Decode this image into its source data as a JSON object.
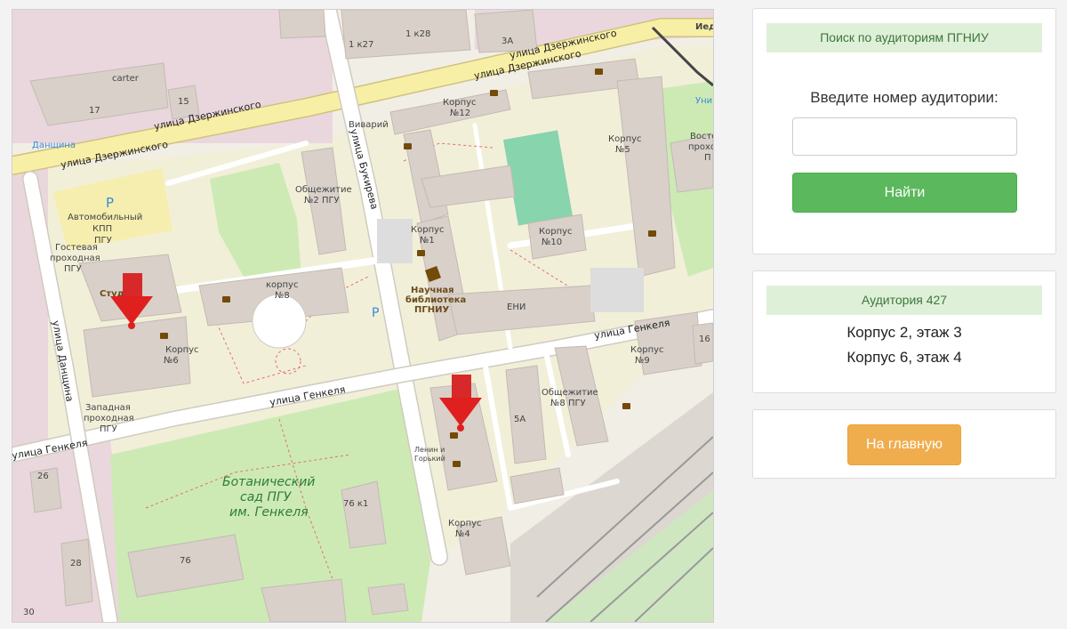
{
  "search": {
    "title": "Поиск по аудиториям ПГНИУ",
    "prompt": "Введите номер аудитории:",
    "input_value": "",
    "button": "Найти"
  },
  "result": {
    "title": "Аудитория 427",
    "lines": [
      "Корпус 2, этаж 3",
      "Корпус 6, этаж 4"
    ]
  },
  "home_button": "На главную",
  "colors": {
    "panel_head_bg": "#dff0d8",
    "panel_head_text": "#3c763d",
    "search_button": "#5cb85c",
    "home_button": "#f0ad4e",
    "marker": "#e0201e"
  },
  "map": {
    "streets": {
      "dzerzhinsky_1": "улица Дзержинского",
      "dzerzhinsky_2": "улица Дзержинского",
      "dzerzhinsky_3": "улица Дзержинского",
      "bukireva": "улица Букирева",
      "genkelya_1": "улица Генкеля",
      "genkelya_2": "улица Генкеля",
      "genkelya_3": "улица Генкеля",
      "danshina": "улица Данщина"
    },
    "labels": {
      "carter": "carter",
      "b17": "17",
      "b15": "15",
      "b1k27": "1 к27",
      "b1k28": "1 к28",
      "b3a": "3А",
      "ied": "Иед",
      "danshina_stop": "Данщина",
      "parking_p": "P",
      "auto_1": "Автомобильный",
      "auto_2": "КПП",
      "auto_3": "ПГУ",
      "guest_1": "Гостевая",
      "guest_2": "проходная",
      "guest_3": "ПГУ",
      "vivarium": "Виварий",
      "k12_1": "Корпус",
      "k12_2": "№12",
      "k5_1": "Корпус",
      "k5_2": "№5",
      "vost_1": "Восто",
      "vost_2": "проход",
      "vost_3": "П",
      "univ": "Унив",
      "obsh2_1": "Общежитие",
      "obsh2_2": "№2 ПГУ",
      "k1_1": "Корпус",
      "k1_2": "№1",
      "k10_1": "Корпус",
      "k10_2": "№10",
      "lib_1": "Научная",
      "lib_2": "библиотека",
      "lib_3": "ПГНИУ",
      "k8_1": "корпус",
      "k8_2": "№8",
      "eni": "ЕНИ",
      "studio": "Студио",
      "k6_1": "Корпус",
      "k6_2": "№6",
      "k9_1": "Корпус",
      "k9_2": "№9",
      "b16": "16",
      "obsh8_1": "Общежитие",
      "obsh8_2": "№8 ПГУ",
      "b5a": "5А",
      "west_1": "Западная",
      "west_2": "проходная",
      "west_3": "ПГУ",
      "lenin_1": "Ленин и",
      "lenin_2": "Горький",
      "garden_1": "Ботанический",
      "garden_2": "сад ПГУ",
      "garden_3": "им. Генкеля",
      "b76k1": "76 к1",
      "b76": "76",
      "k4_1": "Корпус",
      "k4_2": "№4",
      "b26": "26",
      "b28": "28",
      "b30": "30"
    }
  }
}
